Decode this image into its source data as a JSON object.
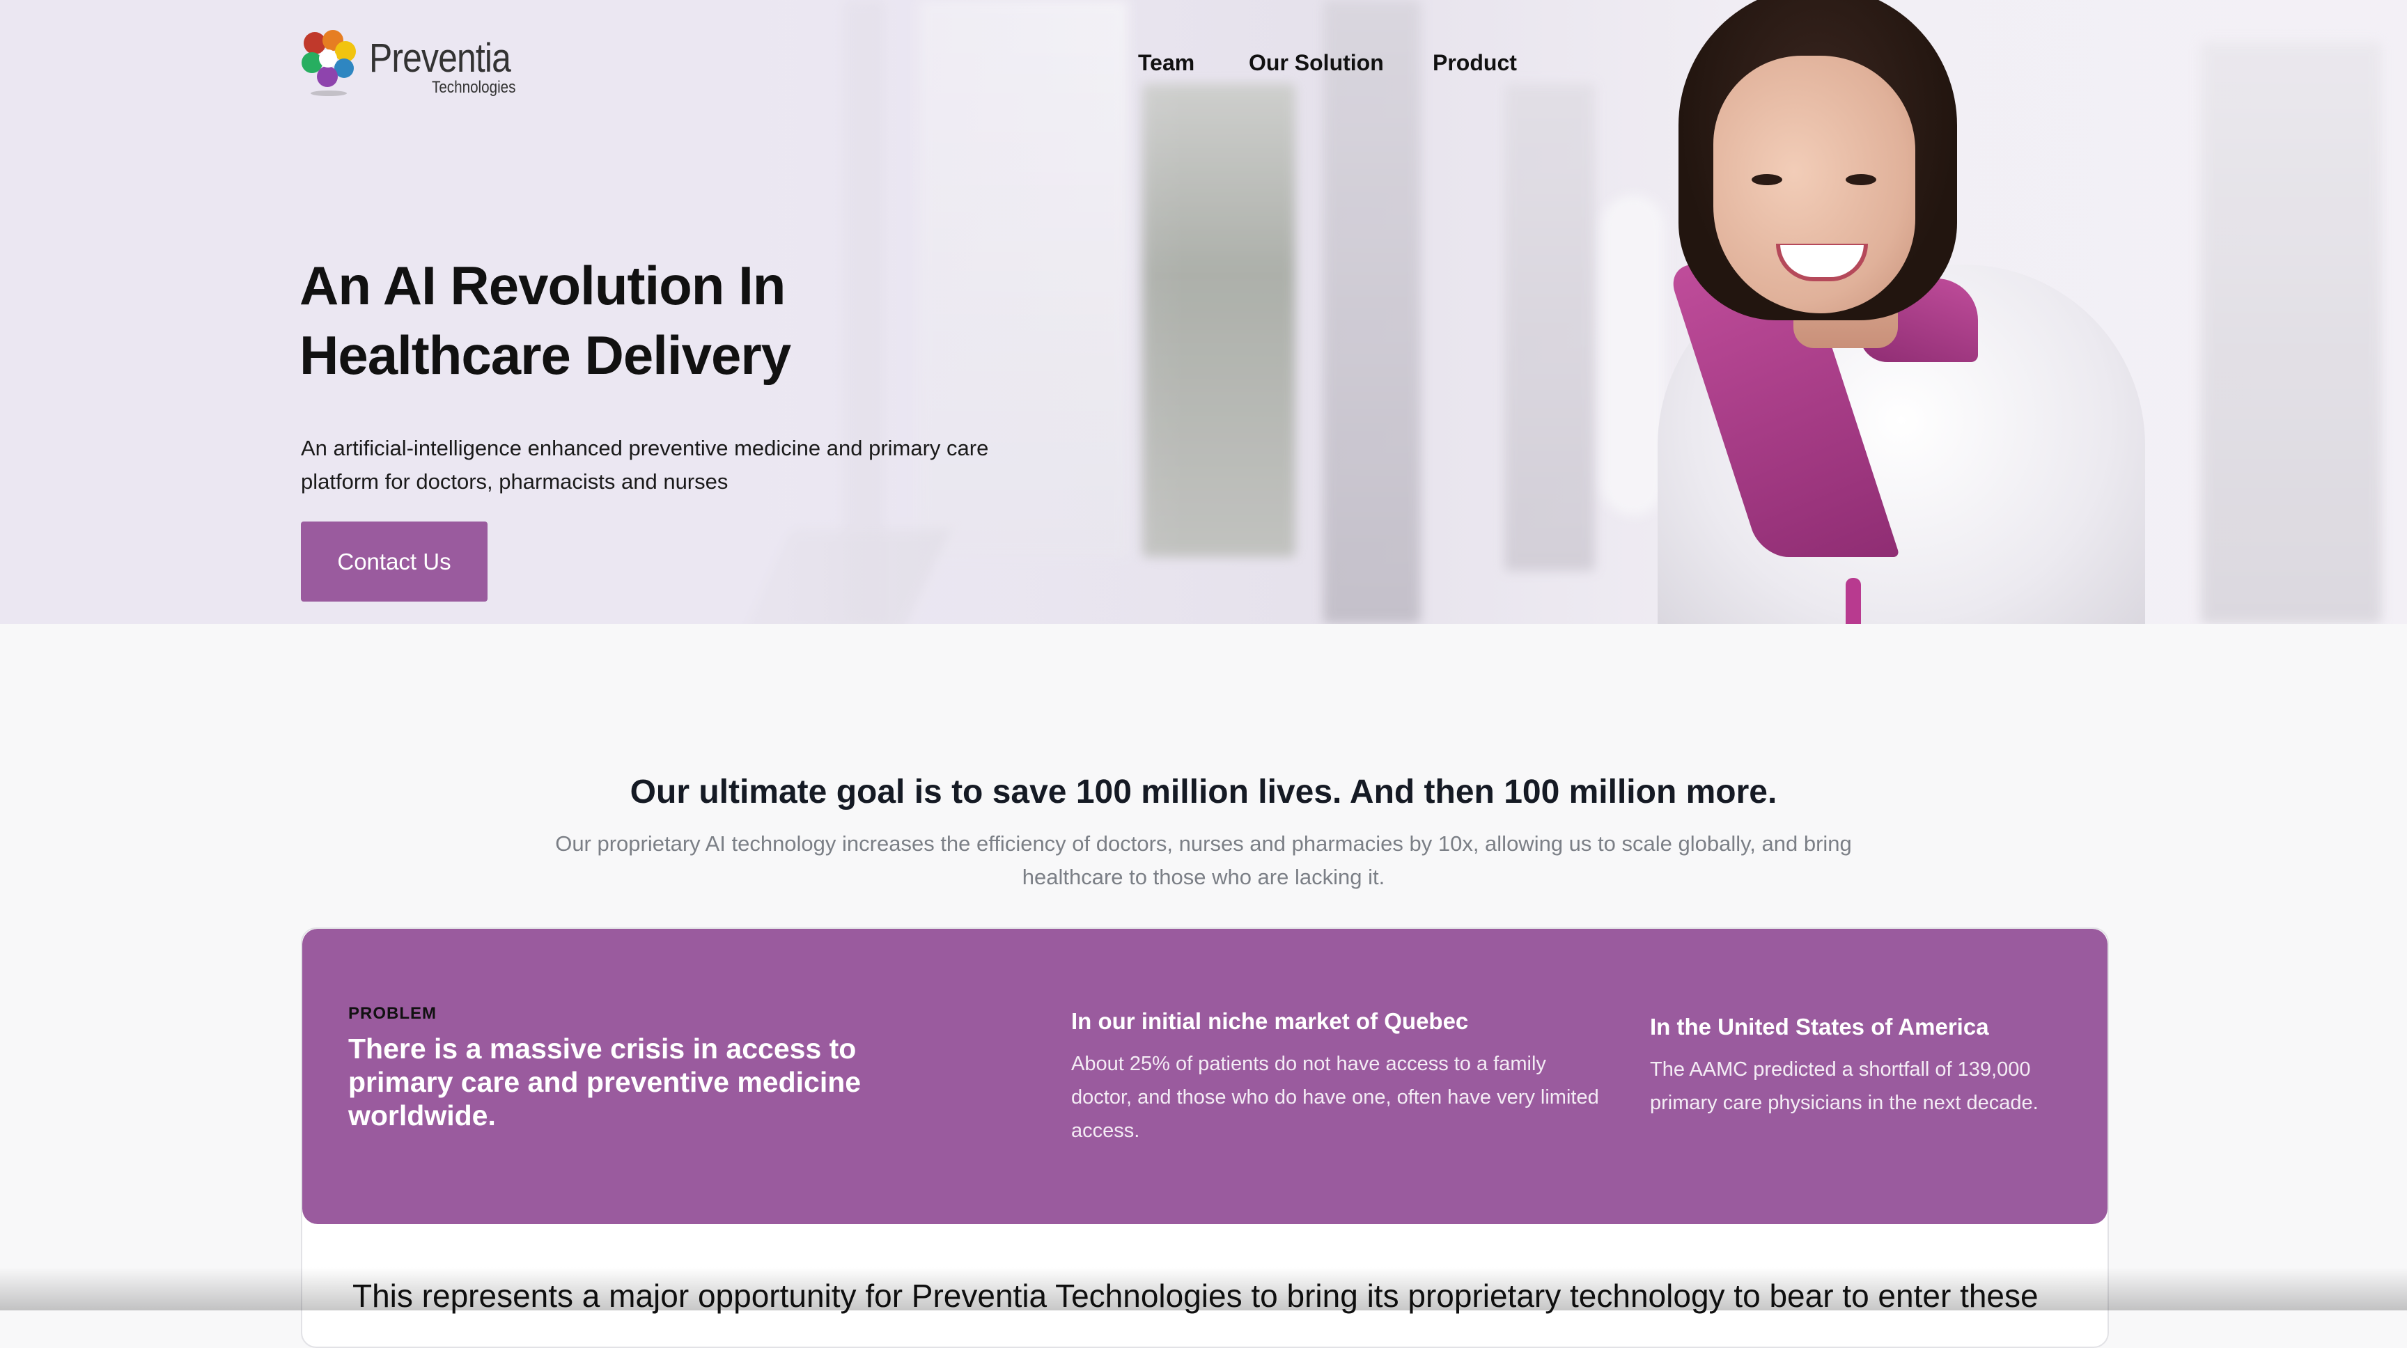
{
  "brand": {
    "name": "Preventia",
    "subtitle": "Technologies",
    "logo_icon": "color-petals-logo",
    "colors": [
      "#c0392b",
      "#f1c40f",
      "#2e86c1",
      "#27ae60",
      "#8e44ad"
    ]
  },
  "nav": {
    "items": [
      {
        "label": "Team"
      },
      {
        "label": "Our Solution"
      },
      {
        "label": "Product"
      }
    ]
  },
  "hero": {
    "title_line1": "An AI Revolution In",
    "title_line2": "Healthcare Delivery",
    "subtitle": "An artificial-intelligence enhanced preventive medicine and primary care platform for doctors, pharmacists and nurses",
    "cta_label": "Contact Us"
  },
  "goal": {
    "title": "Our ultimate goal is to save 100 million lives. And then 100 million more.",
    "subtitle": "Our proprietary AI technology increases the efficiency of doctors, nurses and pharmacies by 10x, allowing us to scale globally, and bring healthcare to those who are lacking it."
  },
  "problem": {
    "label": "PROBLEM",
    "statement": "There is a massive crisis in access to primary care and preventive medicine worldwide.",
    "columns": [
      {
        "title": "In our initial niche market of Quebec",
        "text": "About 25% of patients do not have access to a family doctor, and those who do have one, often have very limited access."
      },
      {
        "title": "In the United States of America",
        "text": "The AAMC predicted a shortfall of 139,000 primary care physicians in the next decade."
      }
    ],
    "opportunity_text": "This represents a major opportunity for Preventia Technologies to bring its proprietary technology to bear to enter these"
  },
  "theme": {
    "accent": "#9a5b9e",
    "text_dark": "#111111",
    "muted": "#7b7f86",
    "background": "#f8f8f9"
  }
}
